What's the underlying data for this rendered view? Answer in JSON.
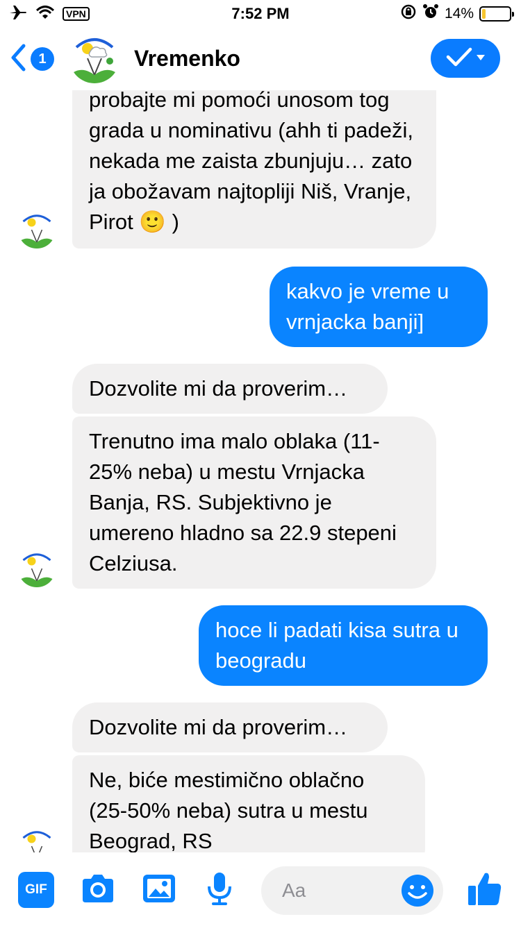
{
  "status_bar": {
    "vpn": "VPN",
    "time": "7:52 PM",
    "battery": "14%",
    "battery_fraction": 0.14
  },
  "header": {
    "back_badge": "1",
    "title": "Vremenko"
  },
  "messages": [
    {
      "from": "bot",
      "text": "probajte mi pomoći unosom tog grada u nominativu (ahh ti padeži, nekada me zaista zbunjuju… zato ja obožavam najtopliji Niš, Vranje, Pirot 🙂 )"
    },
    {
      "from": "user",
      "text": "kakvo je vreme u vrnjacka banji]"
    },
    {
      "from": "bot",
      "text": "Dozvolite mi da proverim…"
    },
    {
      "from": "bot",
      "text": "Trenutno ima malo oblaka (11-25% neba) u mestu Vrnjacka Banja, RS. Subjektivno je umereno hladno sa 22.9 stepeni Celziusa."
    },
    {
      "from": "user",
      "text": "hoce li padati kisa sutra u beogradu"
    },
    {
      "from": "bot",
      "text": "Dozvolite mi da proverim…"
    },
    {
      "from": "bot",
      "text": "Ne, biće mestimično oblačno (25-50% neba) sutra u mestu Beograd, RS"
    }
  ],
  "composer": {
    "gif_label": "GIF",
    "placeholder": "Aa"
  },
  "colors": {
    "accent": "#0a7cff",
    "outgoing_bubble": "#0a84ff",
    "incoming_bubble": "#f1f0f0"
  }
}
